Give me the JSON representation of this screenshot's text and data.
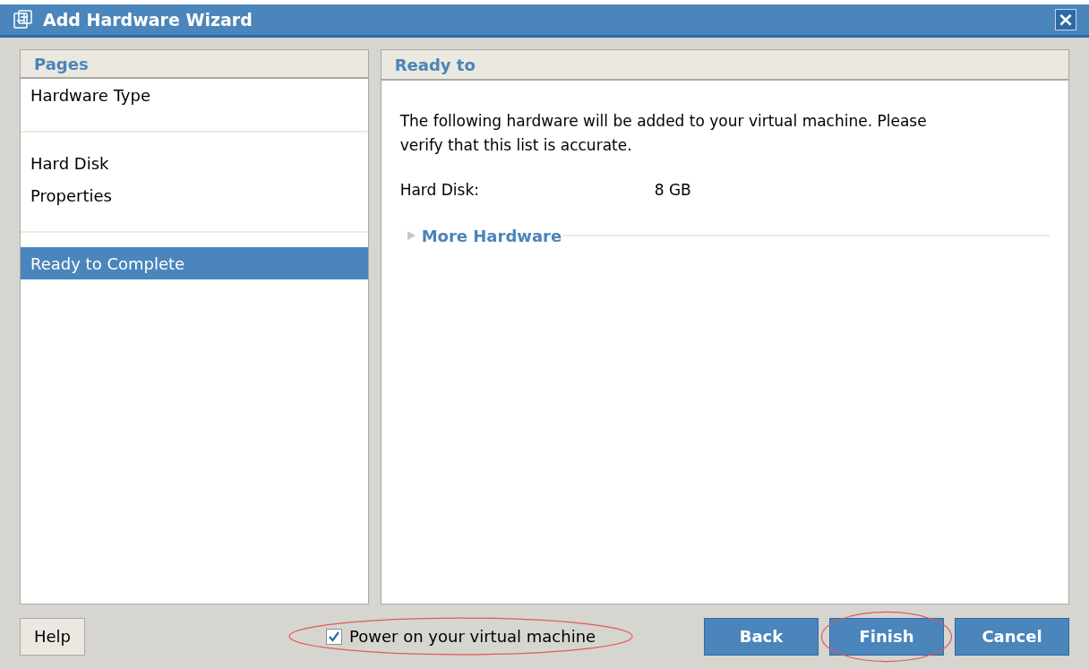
{
  "window": {
    "title": "Add Hardware Wizard",
    "close": "×"
  },
  "pages": {
    "heading": "Pages",
    "groups": [
      {
        "items": [
          {
            "label": "Hardware Type",
            "selected": false
          }
        ]
      },
      {
        "items": [
          {
            "label": "Hard Disk",
            "selected": false
          },
          {
            "label": "Properties",
            "selected": false
          }
        ]
      },
      {
        "items": [
          {
            "label": "Ready to Complete",
            "selected": true
          }
        ]
      }
    ]
  },
  "content": {
    "heading": "Ready to",
    "intro": "The following hardware will be added to your virtual machine. Please verify that this list is accurate.",
    "rows": [
      {
        "label": "Hard Disk:",
        "value": "8 GB"
      }
    ],
    "more": {
      "label": "More Hardware",
      "expanded": false
    }
  },
  "footer": {
    "help": "Help",
    "power_on": {
      "label": "Power on your virtual machine",
      "checked": true,
      "highlighted": true
    },
    "buttons": [
      {
        "label": "Back",
        "highlighted": false
      },
      {
        "label": "Finish",
        "highlighted": true
      },
      {
        "label": "Cancel",
        "highlighted": false
      }
    ]
  }
}
